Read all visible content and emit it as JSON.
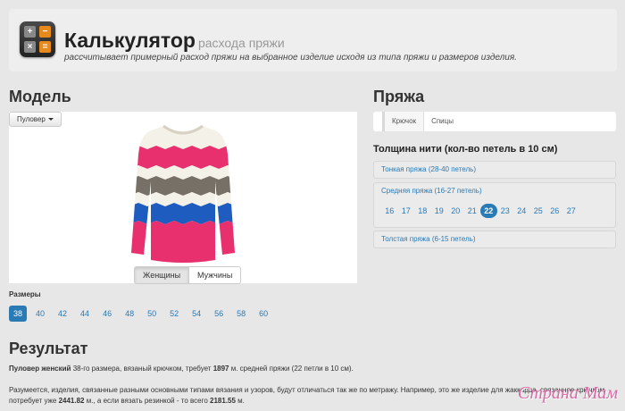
{
  "header": {
    "title": "Калькулятор",
    "title_suffix": "расхода пряжи",
    "subtitle": "рассчитывает примерный расход пряжи на выбранное изделие исходя из типа пряжи и размеров изделия."
  },
  "model": {
    "heading": "Модель",
    "dropdown_label": "Пуловер",
    "gender_buttons": [
      "Женщины",
      "Мужчины"
    ],
    "gender_selected": "Женщины"
  },
  "sizes": {
    "label": "Размеры",
    "values": [
      "38",
      "40",
      "42",
      "44",
      "46",
      "48",
      "50",
      "52",
      "54",
      "56",
      "58",
      "60"
    ],
    "selected": "38"
  },
  "yarn": {
    "heading": "Пряжа",
    "tabs": [
      "Крючок",
      "Спицы"
    ],
    "tab_selected": "Крючок",
    "thickness_label": "Толщина нити (кол-во петель в 10 см)",
    "groups": [
      {
        "label": "Тонкая пряжа (28-40 петель)"
      },
      {
        "label": "Средняя пряжа (16-27 петель)",
        "values": [
          "16",
          "17",
          "18",
          "19",
          "20",
          "21",
          "22",
          "23",
          "24",
          "25",
          "26",
          "27"
        ],
        "selected": "22"
      },
      {
        "label": "Толстая пряжа (6-15 петель)"
      }
    ]
  },
  "result": {
    "heading": "Результат",
    "r1": "Пуловер женский",
    "r2": " 38-го размера, вязаный крючком, требует ",
    "r3": "1897",
    "r4": " м. средней пряжи (22 петли в 10 см).",
    "n1": "Разумеется, изделия, связанные разными основными типами вязания и узоров, будут отличаться так же по метражу. Например, это же изделие для жаккарда, связанное крючком, потребует уже ",
    "n2": "2441.82",
    "n3": " м., а если вязать резинкой - то всего ",
    "n4": "2181.55",
    "n5": " м."
  },
  "watermark": "Страна Мам",
  "colors": {
    "accent": "#2a7ab5",
    "pink": "#e8306e",
    "blue": "#1f5cc0",
    "grey": "#777067",
    "cream": "#f4f1e8"
  }
}
